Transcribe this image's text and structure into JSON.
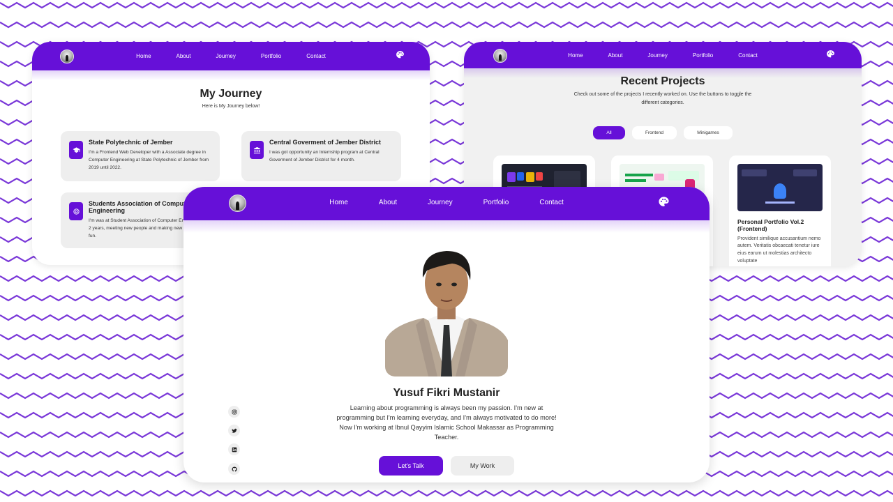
{
  "colors": {
    "accent": "#6610d8",
    "zigzag": "#7a38d8",
    "card_bg": "#ffffff",
    "tile_bg": "#eeeeee"
  },
  "journey": {
    "nav": [
      "Home",
      "About",
      "Journey",
      "Portfolio",
      "Contact"
    ],
    "title": "My Journey",
    "subtitle": "Here is My Journey below!",
    "items": [
      {
        "icon": "graduation-cap-icon",
        "title": "State Polytechnic of Jember",
        "text": "I'm a Frontend Web Developer with a Associate degree in Computer Engineering at State Polytechnic of Jember from 2019 until 2022."
      },
      {
        "icon": "building-icon",
        "title": "Central Goverment of Jember District",
        "text": "I was got opportunity an Internship program at Central Goverment of Jember District for 4 month."
      },
      {
        "icon": "badge-icon",
        "title": "Students Association of Computer Engineering",
        "text": "I'm was at Student Association of Computer Engineering for 2 years, meeting new people and making new contacts is fun."
      }
    ]
  },
  "projects": {
    "nav": [
      "Home",
      "About",
      "Journey",
      "Portfolio",
      "Contact"
    ],
    "title": "Recent Projects",
    "subtitle": "Check out some of the projects I recently worked on. Use the buttons to toggle the different categories.",
    "filters": [
      "All",
      "Frontend",
      "Minigames"
    ],
    "active_filter": "All",
    "cards": [
      {
        "thumb": "coding-badges-thumbnail",
        "title": "",
        "text": ""
      },
      {
        "thumb": "landing-page-thumbnail",
        "title": "",
        "text": ""
      },
      {
        "thumb": "portfolio-thumbnail",
        "title": "Personal Portfolio Vol.2 (Frontend)",
        "text": "Provident similique accusantium nemo autem. Veritatis obcaecati tenetur iure eius earum ut molestias architecto voluptate"
      }
    ]
  },
  "main": {
    "nav": [
      "Home",
      "About",
      "Journey",
      "Portfolio",
      "Contact"
    ],
    "name": "Yusuf Fikri Mustanir",
    "bio": "Learning about programming is always been my passion. I'm new at programming but I'm learning everyday, and I'm always motivated to do more! Now I'm working at Ibnul Qayyim Islamic School Makassar as Programming Teacher.",
    "primary_button": "Let's Talk",
    "secondary_button": "My Work",
    "socials": [
      "instagram-icon",
      "twitter-icon",
      "linkedin-icon",
      "github-icon"
    ]
  }
}
